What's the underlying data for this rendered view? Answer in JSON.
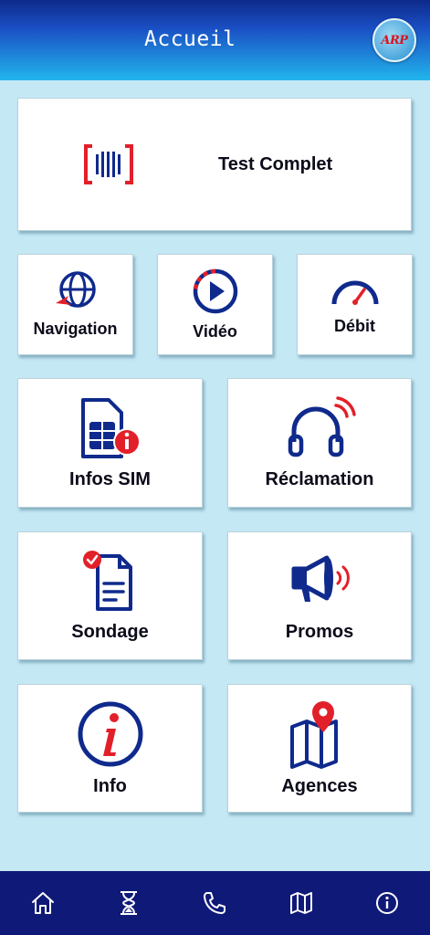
{
  "header": {
    "title": "Accueil",
    "logo_text": "ARP"
  },
  "cards": {
    "test_complet": "Test Complet",
    "navigation": "Navigation",
    "video": "Vidéo",
    "debit": "Débit",
    "infos_sim": "Infos SIM",
    "reclamation": "Réclamation",
    "sondage": "Sondage",
    "promos": "Promos",
    "info": "Info",
    "agences": "Agences"
  },
  "bottom_nav": [
    {
      "icon": "home-icon"
    },
    {
      "icon": "hourglass-icon"
    },
    {
      "icon": "phone-icon"
    },
    {
      "icon": "map-icon"
    },
    {
      "icon": "info-icon"
    }
  ],
  "colors": {
    "primary_blue": "#0f2a8c",
    "accent_red": "#e2202a",
    "background": "#c5e8f5",
    "bottom_bar": "#0f1a78"
  }
}
